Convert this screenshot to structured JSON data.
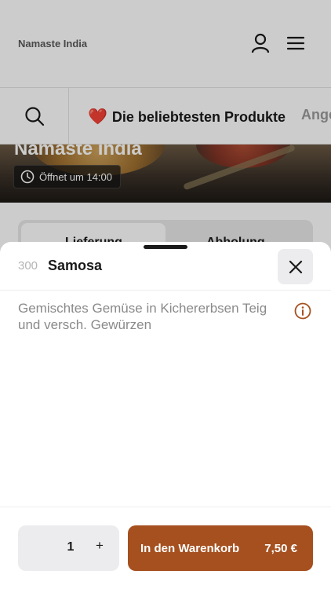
{
  "header": {
    "brand": "Namaste India",
    "icons": [
      "user-icon",
      "menu-icon"
    ]
  },
  "categories": {
    "search_icon": "search-icon",
    "active": {
      "emoji": "❤️",
      "label": "Die beliebtesten Produkte"
    },
    "next": "Ange"
  },
  "hero": {
    "title": "Namaste India",
    "opening": "Öffnet um 14:00"
  },
  "delivery_toggle": {
    "option1": "Lieferung",
    "option2": "Abholung"
  },
  "product": {
    "number": "300",
    "name": "Samosa",
    "description": "Gemischtes Gemüse in Kichererbsen Teig und versch. Gewürzen"
  },
  "footer": {
    "quantity": "1",
    "plus": "+",
    "add_to_cart": "In den Warenkorb",
    "price": "7,50 €"
  },
  "colors": {
    "accent": "#a6501f",
    "heart": "#c8102e",
    "info_icon": "#a6501f"
  }
}
